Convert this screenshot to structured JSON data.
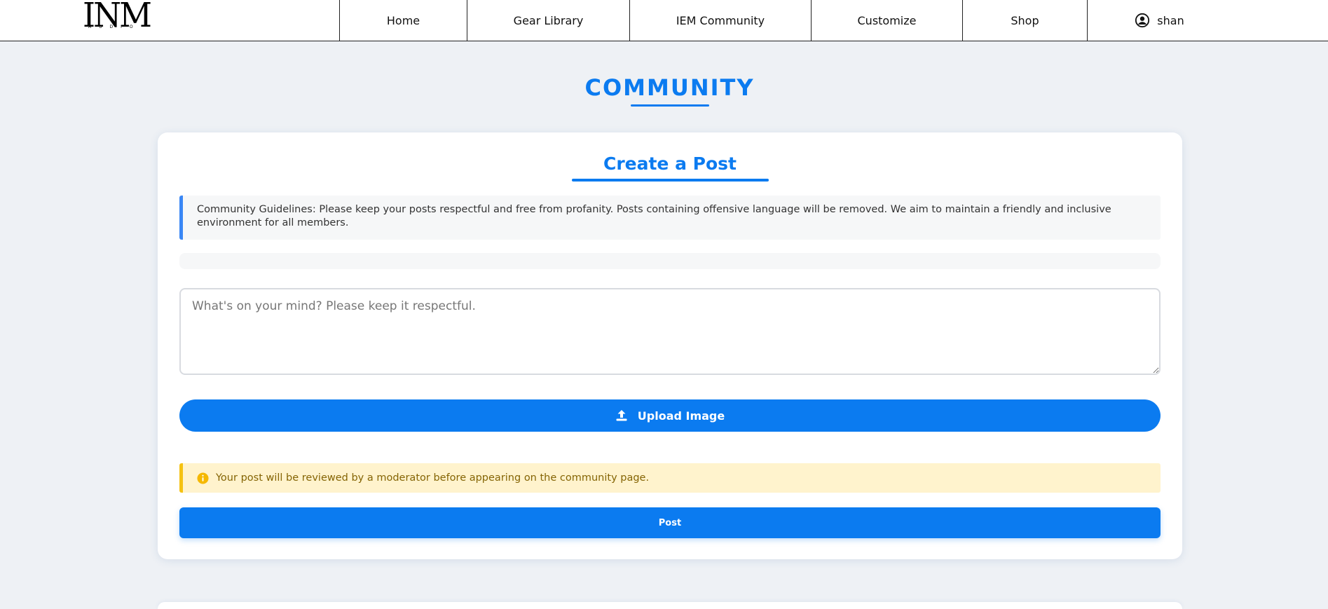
{
  "brand": {
    "logo_text": "INM",
    "logo_sub": "AUDIO"
  },
  "nav": {
    "items": [
      {
        "label": "Home"
      },
      {
        "label": "Gear Library"
      },
      {
        "label": "IEM Community"
      },
      {
        "label": "Customize"
      },
      {
        "label": "Shop"
      }
    ],
    "user": {
      "name": "shan",
      "icon": "user-circle-icon"
    }
  },
  "page": {
    "title": "COMMUNITY"
  },
  "create_post": {
    "title": "Create a Post",
    "guidelines": "Community Guidelines: Please keep your posts respectful and free from profanity. Posts containing offensive language will be removed. We aim to maintain a friendly and inclusive environment for all members.",
    "textarea_placeholder": "What's on your mind? Please keep it respectful.",
    "textarea_value": "",
    "upload_label": "Upload Image",
    "upload_icon": "upload-icon",
    "moderation_notice": "Your post will be reviewed by a moderator before appearing on the community page.",
    "notice_icon": "info-icon",
    "post_label": "Post"
  },
  "colors": {
    "accent": "#0b7bf0",
    "background": "#eef1f5",
    "notice_bg": "#fff3cd",
    "notice_border": "#f5c211",
    "notice_text": "#856404"
  }
}
